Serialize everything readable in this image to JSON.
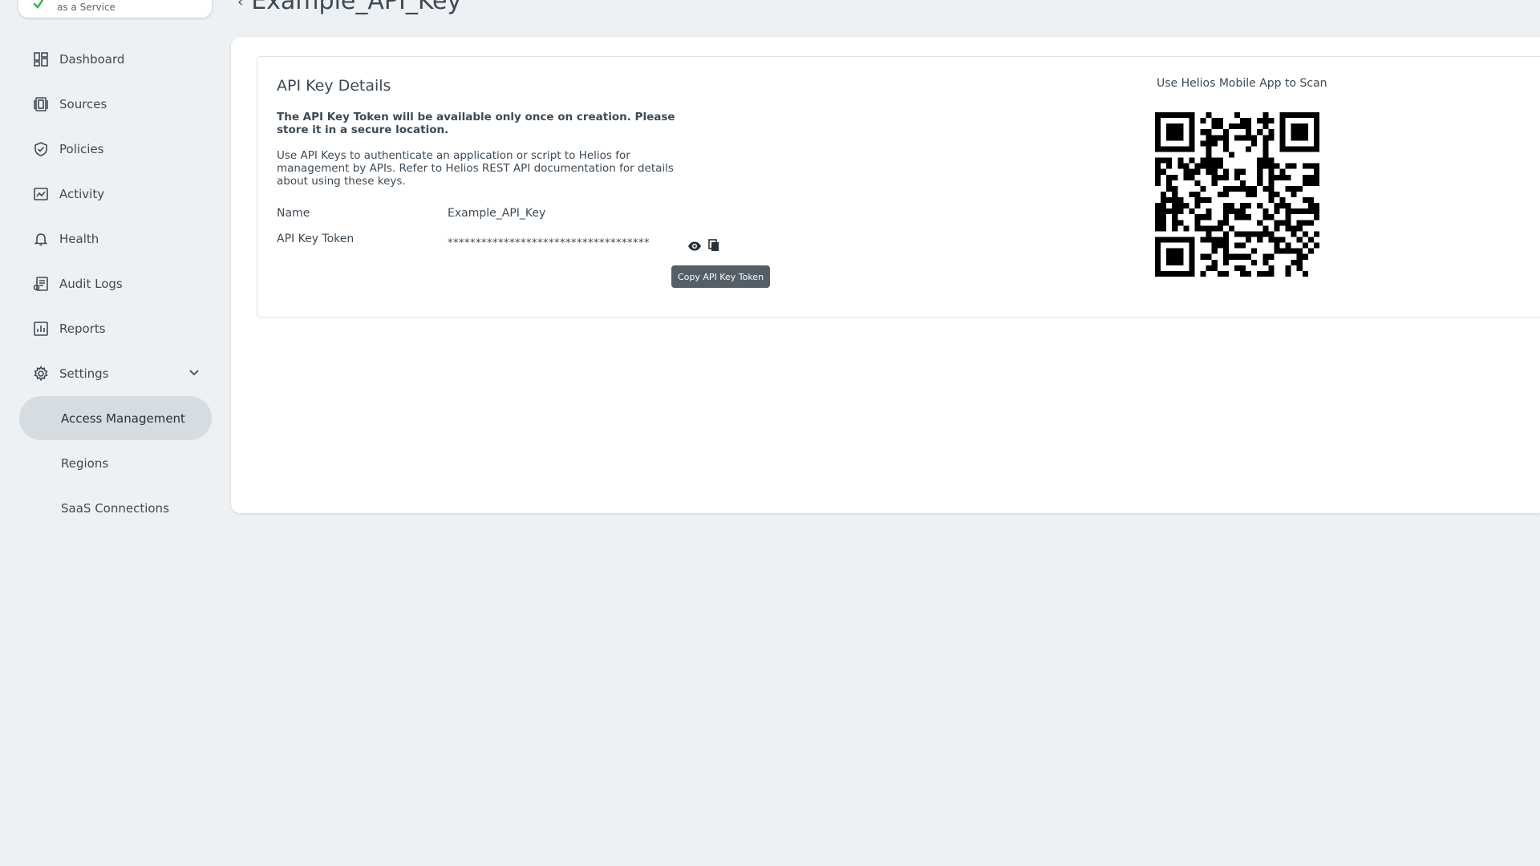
{
  "header": {
    "logo_subtitle": "as a Service",
    "page_title": "Example_API_Key"
  },
  "sidebar": {
    "items": [
      {
        "label": "Dashboard",
        "icon": "dashboard-icon"
      },
      {
        "label": "Sources",
        "icon": "sources-icon"
      },
      {
        "label": "Policies",
        "icon": "shield-check-icon"
      },
      {
        "label": "Activity",
        "icon": "activity-icon"
      },
      {
        "label": "Health",
        "icon": "bell-icon"
      },
      {
        "label": "Audit Logs",
        "icon": "audit-logs-icon"
      },
      {
        "label": "Reports",
        "icon": "bar-chart-icon"
      },
      {
        "label": "Settings",
        "icon": "gear-icon",
        "expanded": true
      }
    ],
    "settings_sub": [
      {
        "label": "Access Management",
        "active": true
      },
      {
        "label": "Regions",
        "active": false
      },
      {
        "label": "SaaS Connections",
        "active": false
      }
    ]
  },
  "details": {
    "title": "API Key Details",
    "warning": "The API Key Token will be available only once on creation. Please store it in a secure location.",
    "description": "Use API Keys to authenticate an application or script to Helios for management by APIs. Refer to Helios REST API documentation for details about using these keys.",
    "name_label": "Name",
    "name_value": "Example_API_Key",
    "token_label": "API Key Token",
    "token_value": "************************************",
    "tooltip": "Copy API Key Token"
  },
  "qr": {
    "title": "Use Helios Mobile App to Scan"
  },
  "colors": {
    "accent_green": "#3bb54a",
    "active_nav_bg": "#d6dde2",
    "page_bg": "#eef1f3"
  }
}
